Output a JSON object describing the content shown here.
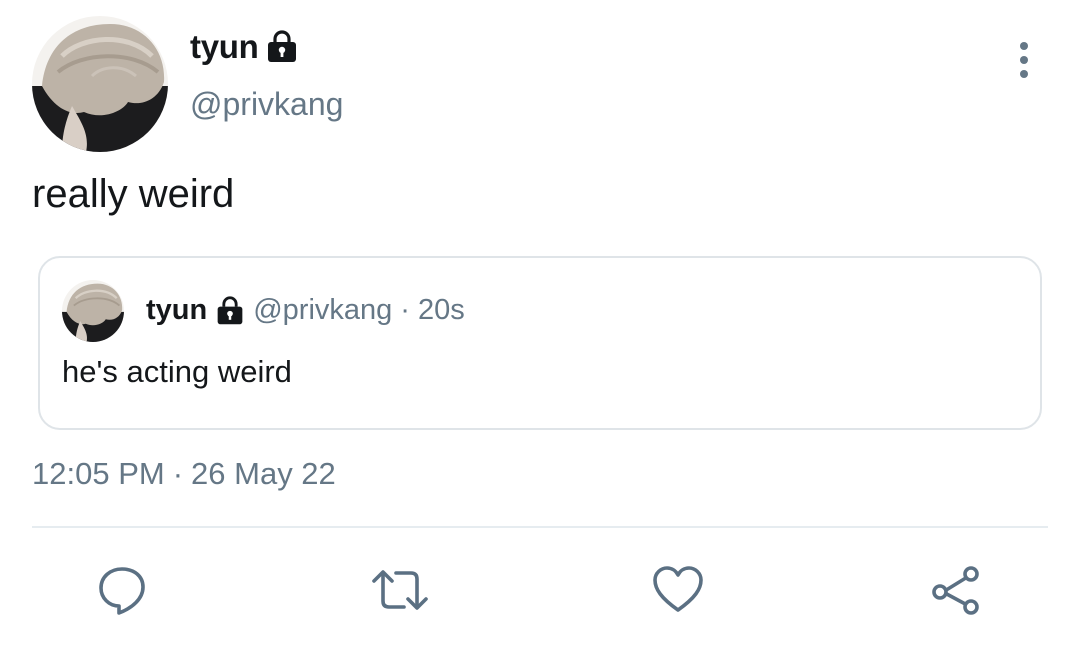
{
  "tweet": {
    "author": {
      "display_name": "tyun",
      "handle": "@privkang",
      "protected_icon": "lock-icon"
    },
    "more_icon": "more-vertical-icon",
    "text": "really weird",
    "quoted": {
      "display_name": "tyun",
      "handle": "@privkang",
      "separator": "·",
      "time": "20s",
      "text": "he's acting weird",
      "protected_icon": "lock-icon"
    },
    "meta": {
      "time": "12:05 PM",
      "separator": "·",
      "date": "26 May 22"
    },
    "actions": [
      {
        "icon": "reply-icon"
      },
      {
        "icon": "retweet-icon"
      },
      {
        "icon": "like-icon"
      },
      {
        "icon": "share-icon"
      }
    ]
  },
  "colors": {
    "primary_text": "#14171a",
    "secondary_text": "#657786",
    "border": "#dfe4e8",
    "icon": "#5b7083"
  }
}
